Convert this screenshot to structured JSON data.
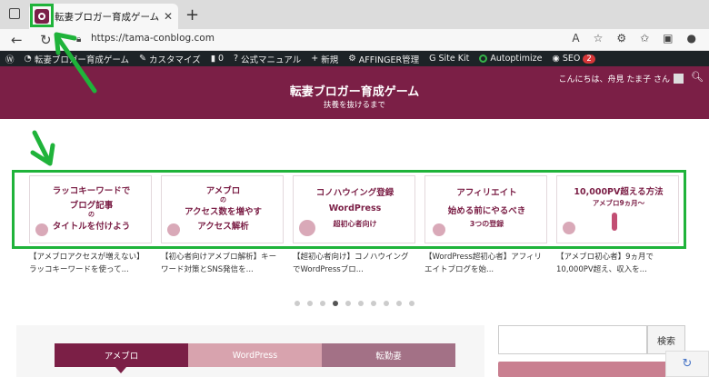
{
  "browser": {
    "tab_title": "転妻ブロガー育成ゲーム - 扶養を抜ける",
    "tab_close": "✕",
    "new_tab": "+",
    "url": "https://tama-conblog.com"
  },
  "admin_bar": {
    "items": [
      {
        "icon": "wordpress-icon",
        "label": "W"
      },
      {
        "icon": "dashboard-icon",
        "label": "転妻ブロガー育成ゲーム"
      },
      {
        "icon": "brush-icon",
        "label": "カスタマイズ"
      },
      {
        "icon": "comment-icon",
        "label": "0"
      },
      {
        "icon": "question-icon",
        "label": "公式マニュアル"
      },
      {
        "icon": "plus-icon",
        "label": "新規"
      },
      {
        "icon": "gear-icon",
        "label": "AFFINGER管理"
      },
      {
        "icon": "sitekit-icon",
        "label": "Site Kit"
      },
      {
        "icon": "autoptimize-icon",
        "label": "Autoptimize"
      },
      {
        "icon": "seo-icon",
        "label": "SEO"
      }
    ],
    "seo_badge": "2"
  },
  "site": {
    "title": "転妻ブロガー育成ゲーム",
    "tagline": "扶養を抜けるまで",
    "greeting": "こんにちは、舟見 たま子 さん"
  },
  "slider": {
    "cards": [
      {
        "lines": [
          "ラッコキーワードで",
          "ブログ記事",
          "の",
          "タイトルを付けよう"
        ],
        "caption": "【アメブロアクセスが増えない】ラッコキーワードを使って..."
      },
      {
        "lines": [
          "アメブロ",
          "の",
          "アクセス数を増やす",
          "アクセス解析"
        ],
        "caption": "【初心者向けアメブロ解析】キーワード対策とSNS発信を..."
      },
      {
        "lines": [
          "コノハウイング登録",
          "WordPress",
          "超初心者向け"
        ],
        "caption": "【超初心者向け】コノハウイングでWordPressブロ..."
      },
      {
        "lines": [
          "アフィリエイト",
          "始める前にやるべき",
          "3つの登録"
        ],
        "caption": "【WordPress超初心者】アフィリエイトブログを始..."
      },
      {
        "lines": [
          "10,000PV超える方法",
          "アメブロ9ヵ月～"
        ],
        "caption": "【アメブロ初心者】9ヵ月で10,000PV超え、収入を..."
      }
    ],
    "dots_total": 10,
    "dots_active_index": 3
  },
  "content_tabs": [
    "アメブロ",
    "WordPress",
    "転勤妻"
  ],
  "sidebar": {
    "search_button": "検索"
  },
  "colors": {
    "brand": "#7b1f46",
    "highlight": "#1fb33a"
  }
}
